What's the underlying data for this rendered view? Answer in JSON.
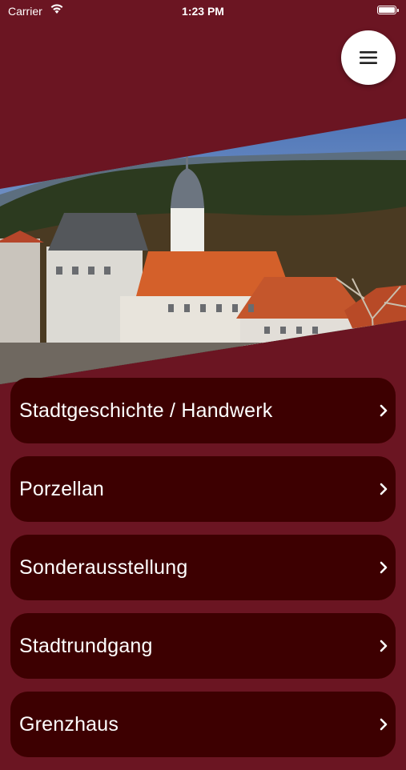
{
  "status_bar": {
    "carrier": "Carrier",
    "time": "1:23 PM"
  },
  "header": {
    "menu_icon": "hamburger-menu-icon"
  },
  "menu": {
    "items": [
      {
        "label": "Stadtgeschichte / Handwerk"
      },
      {
        "label": "Porzellan"
      },
      {
        "label": "Sonderausstellung"
      },
      {
        "label": "Stadtrundgang"
      },
      {
        "label": "Grenzhaus"
      }
    ]
  },
  "colors": {
    "background": "#6b1522",
    "item_background": "#3d0001",
    "text": "#ffffff"
  }
}
